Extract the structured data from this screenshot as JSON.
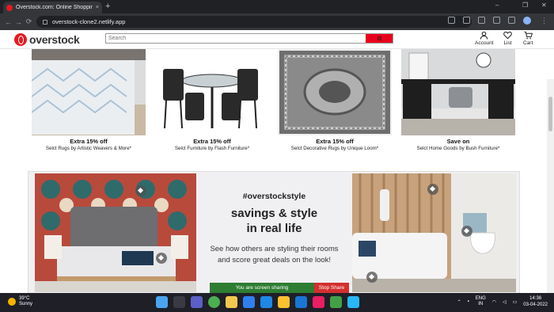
{
  "browser": {
    "tab_title": "Overstock.com: Online Shopping",
    "tab_close": "×",
    "new_tab": "+",
    "url": "overstock-clone2.netlify.app",
    "window_controls": [
      "⌄",
      "–",
      "❐",
      "✕"
    ],
    "nav": [
      "←",
      "→",
      "⟳"
    ]
  },
  "site": {
    "logo_text": "overstock",
    "search_placeholder": "Search",
    "header_icons": [
      {
        "label": "Account",
        "icon": "account-icon"
      },
      {
        "label": "List",
        "icon": "heart-icon"
      },
      {
        "label": "Cart",
        "icon": "cart-icon"
      }
    ]
  },
  "products": [
    {
      "line1": "Extra 15% off",
      "line2": "Selct Rugs by Artistic Weavers & More*"
    },
    {
      "line1": "Extra 15% off",
      "line2": "Selct Furniture by Flash Furniture*"
    },
    {
      "line1": "Extra 15% off",
      "line2": "Selct Decorative Rugs by Unique Loom*"
    },
    {
      "line1": "Save on",
      "line2": "Selct Home Goods by Bush Furniture*"
    }
  ],
  "banner": {
    "hashtag": "#overstockstyle",
    "headline_1": "savings & style",
    "headline_2": "in real life",
    "sub_1": "See how others are styling their rooms",
    "sub_2": "and score great deals on the look!"
  },
  "share_bar": {
    "sharing_text": "You are screen sharing",
    "stop_text": "Stop Share"
  },
  "taskbar": {
    "temp": "39°C",
    "condition": "Sunny",
    "lang_1": "ENG",
    "lang_2": "IN",
    "time": "14:36",
    "date": "03-04-2022"
  },
  "colors": {
    "brand_red": "#e31b23",
    "search_red": "#e8001c",
    "taskbar": "#1f1f28"
  }
}
